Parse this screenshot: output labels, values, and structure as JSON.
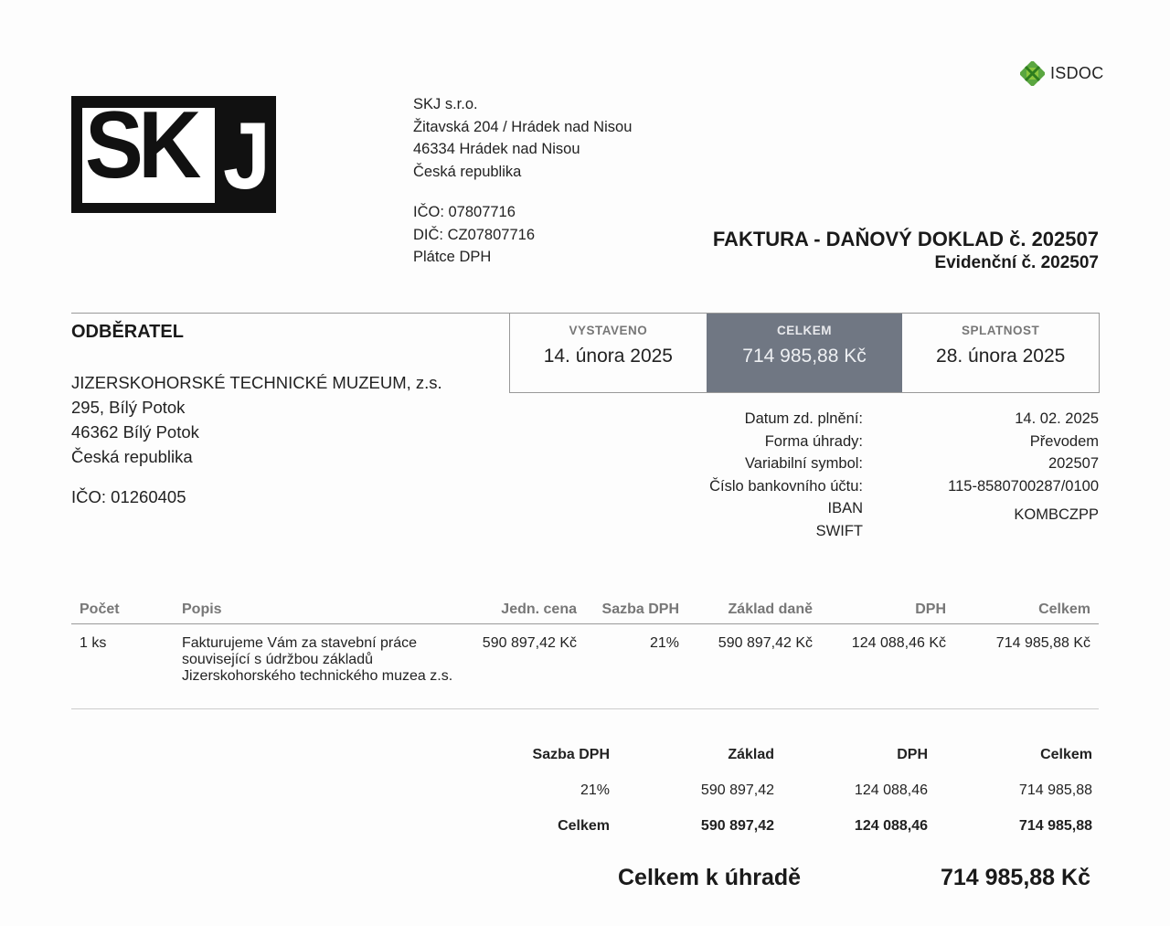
{
  "badge": {
    "icon": "isdoc-logo-icon",
    "text": "ISDOC"
  },
  "logo": {
    "text_sk": "SK",
    "text_j": "J"
  },
  "seller": {
    "name": "SKJ s.r.o.",
    "address1": "Žitavská 204 / Hrádek nad Nisou",
    "address2": "46334 Hrádek nad Nisou",
    "country": "Česká republika",
    "ico": "IČO: 07807716",
    "dic": "DIČ: CZ07807716",
    "vat_status": "Plátce DPH"
  },
  "title": {
    "main": "FAKTURA - DAŇOVÝ DOKLAD č. 202507",
    "sub": "Evidenční č. 202507"
  },
  "buyer": {
    "heading": "ODBĚRATEL",
    "name": "JIZERSKOHORSKÉ TECHNICKÉ MUZEUM, z.s.",
    "address1": "295, Bílý Potok",
    "address2": "46362 Bílý Potok",
    "country": "Česká republika",
    "ico": "IČO: 01260405"
  },
  "summary": [
    {
      "label": "VYSTAVENO",
      "value": "14. února 2025"
    },
    {
      "label": "CELKEM",
      "value": "714 985,88 Kč"
    },
    {
      "label": "SPLATNOST",
      "value": "28. února 2025"
    }
  ],
  "payment": [
    {
      "label": "Datum zd. plnění:",
      "value": "14. 02. 2025"
    },
    {
      "label": "Forma úhrady:",
      "value": "Převodem"
    },
    {
      "label": "Variabilní symbol:",
      "value": "202507"
    },
    {
      "label": "Číslo bankovního účtu:",
      "value": "115-8580700287/0100"
    },
    {
      "label": "IBAN",
      "value": ""
    },
    {
      "label": "SWIFT",
      "value": "KOMBCZPP"
    }
  ],
  "items": {
    "headers": [
      "Počet",
      "Popis",
      "Jedn. cena",
      "Sazba DPH",
      "Základ daně",
      "DPH",
      "Celkem"
    ],
    "rows": [
      {
        "qty": "1 ks",
        "desc": "Fakturujeme Vám za stavební práce související s údržbou základů Jizerskohorského technického muzea z.s.",
        "unit_price": "590 897,42 Kč",
        "vat_rate": "21%",
        "base": "590 897,42 Kč",
        "vat": "124 088,46 Kč",
        "total": "714 985,88 Kč"
      }
    ]
  },
  "vat_summary": {
    "headers": [
      "Sazba DPH",
      "Základ",
      "DPH",
      "Celkem"
    ],
    "rows": [
      {
        "rate": "21%",
        "base": "590 897,42",
        "vat": "124 088,46",
        "total": "714 985,88"
      }
    ],
    "totals": {
      "label": "Celkem",
      "base": "590 897,42",
      "vat": "124 088,46",
      "total": "714 985,88"
    }
  },
  "grand_total": {
    "label": "Celkem k úhradě",
    "value": "714 985,88 Kč"
  }
}
